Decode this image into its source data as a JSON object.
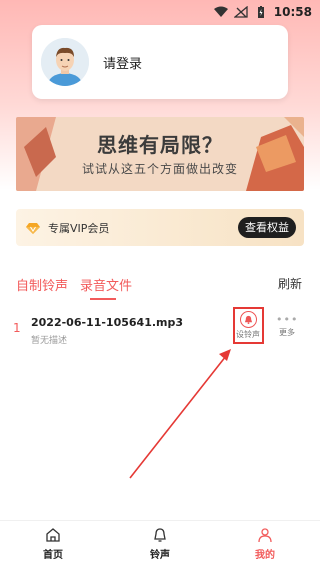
{
  "status_bar": {
    "time": "10:58"
  },
  "login": {
    "label": "请登录"
  },
  "banner": {
    "title": "思维有局限？",
    "subtitle": "试试从这五个方面做出改变"
  },
  "vip": {
    "label": "专属VIP会员",
    "button": "查看权益"
  },
  "tabs": [
    {
      "label": "自制铃声",
      "active": false
    },
    {
      "label": "录音文件",
      "active": true
    }
  ],
  "refresh_label": "刷新",
  "items": [
    {
      "index": "1",
      "name": "2022-06-11-105641.mp3",
      "description": "暂无描述",
      "ringtone_label": "设铃声",
      "more_label": "更多"
    }
  ],
  "bottom_nav": [
    {
      "label": "首页",
      "icon": "home-icon"
    },
    {
      "label": "铃声",
      "icon": "bell-icon"
    },
    {
      "label": "我的",
      "icon": "person-icon",
      "active": true
    }
  ],
  "colors": {
    "accent": "#f25b5b",
    "annotation": "#e53935"
  }
}
